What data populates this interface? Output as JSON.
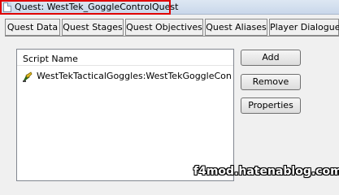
{
  "window": {
    "title": "Quest: WestTek_GoggleControlQuest",
    "icon": "document-icon",
    "highlight_color": "#e00000"
  },
  "tabs": [
    {
      "label": "Quest Data"
    },
    {
      "label": "Quest Stages"
    },
    {
      "label": "Quest Objectives"
    },
    {
      "label": "Quest Aliases"
    },
    {
      "label": "Player Dialogue"
    }
  ],
  "scripts": {
    "column_header": "Script Name",
    "rows": [
      {
        "name": "WestTekTacticalGoggles:WestTekGoggleCon...",
        "icon": "script-icon"
      }
    ]
  },
  "buttons": {
    "add": "Add",
    "remove": "Remove",
    "properties": "Properties"
  },
  "watermark": "f4mod.hatenablog.com"
}
